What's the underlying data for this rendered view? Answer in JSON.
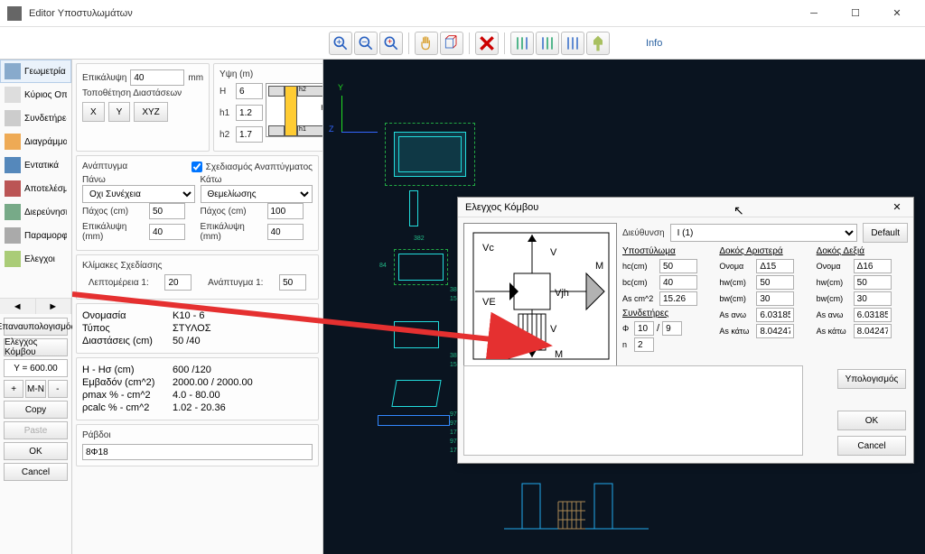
{
  "titlebar": {
    "title": "Editor Υποστυλωμάτων"
  },
  "toolbar": {
    "info": "Info"
  },
  "nav": {
    "items": [
      {
        "label": "Γεωμετρία"
      },
      {
        "label": "Κύριος Οπλισ"
      },
      {
        "label": "Συνδετήρες"
      },
      {
        "label": "Διαγράμματα"
      },
      {
        "label": "Εντατικά"
      },
      {
        "label": "Αποτελέσματ"
      },
      {
        "label": "Διερεύνηση"
      },
      {
        "label": "Παραμορφώσ"
      },
      {
        "label": "Ελεγχοι"
      }
    ],
    "recalc": "Επαναυπολογισμός",
    "node_check": "Ελεγχος Κόμβου",
    "y_value": "Y = 600.00",
    "plus": "+",
    "mn": "M-N",
    "minus": "-",
    "copy": "Copy",
    "paste": "Paste",
    "ok": "OK",
    "cancel": "Cancel"
  },
  "props": {
    "epikalypsi_label": "Επικάλυψη",
    "epikalypsi": "40",
    "mm": "mm",
    "topothetisi": "Τοποθέτηση Διαστάσεων",
    "x": "X",
    "y": "Y",
    "xyz": "XYZ",
    "ypsi": "Υψη (m)",
    "hl": "H",
    "h": "6",
    "h1l": "h1",
    "h1": "1.2",
    "h2l": "h2",
    "h2": "1.7",
    "anaptygma": "Ανάπτυγμα",
    "sxediasmos": "Σχεδιασμός Αναπτύγματος",
    "pano": "Πάνω",
    "kato": "Κάτω",
    "pano_sel": "Οχι Συνέχεια",
    "kato_sel": "Θεμελίωσης",
    "paxos": "Πάχος (cm)",
    "paxos_p": "50",
    "paxos_k": "100",
    "epik_mm": "Επικάλυψη (mm)",
    "epik_p": "40",
    "epik_k": "40",
    "klimakes": "Κλίμακες Σχεδίασης",
    "lepto": "Λεπτομέρεια 1:",
    "lepto_v": "20",
    "anap": "Ανάπτυγμα 1:",
    "anap_v": "50",
    "info": [
      {
        "k": "Ονομασία",
        "v": "K10 - 6"
      },
      {
        "k": "Τύπος",
        "v": "ΣΤΥΛΟΣ"
      },
      {
        "k": "Διαστάσεις (cm)",
        "v": "50  /40"
      }
    ],
    "info2": [
      {
        "k": "H - Hσ (cm)",
        "v": "600  /120"
      },
      {
        "k": "Εμβαδόν (cm^2)",
        "v": "2000.00 / 2000.00"
      },
      {
        "k": "ρmax % - cm^2",
        "v": "4.0 - 80.00"
      },
      {
        "k": "ρcalc % - cm^2",
        "v": "1.02 - 20.36"
      }
    ],
    "ravdoi": "Ράβδοι",
    "ravdoi_v": "8Φ18"
  },
  "canvas": {
    "y": "Y",
    "z": "Z"
  },
  "dialog": {
    "title": "Ελεγχος Κόμβου",
    "dieythinsi": "Διεύθυνση",
    "dir_sel": "I (1)",
    "default": "Default",
    "ypostyloma": "Υποστύλωμα",
    "dokos_a": "Δοκός Αριστερά",
    "dokos_d": "Δοκός Δεξιά",
    "hc": "hc(cm)",
    "hc_v": "50",
    "bc": "bc(cm)",
    "bc_v": "40",
    "as": "As cm^2",
    "as_v": "15.26",
    "synd": "Συνδετήρες",
    "phi": "Φ",
    "phi_v": "10",
    "slash": "/",
    "slash_v": "9",
    "n": "n",
    "n_v": "2",
    "onoma": "Ονομα",
    "onoma_a": "Δ15",
    "onoma_d": "Δ16",
    "hw": "hw(cm)",
    "hw_a": "50",
    "hw_d": "50",
    "bw": "bw(cm)",
    "bw_a": "30",
    "bw_d": "30",
    "as_ano": "As ανω",
    "as_ano_a": "6.03185",
    "as_ano_d": "6.03185",
    "as_kato": "As κάτω",
    "as_kato_a": "8.04247",
    "as_kato_d": "8.04247",
    "ypol": "Υπολογισμός",
    "ok": "OK",
    "cancel": "Cancel",
    "diag": {
      "v": "V",
      "m": "M",
      "vc": "Vc",
      "ve": "VE",
      "vjh": "Vjh"
    }
  }
}
